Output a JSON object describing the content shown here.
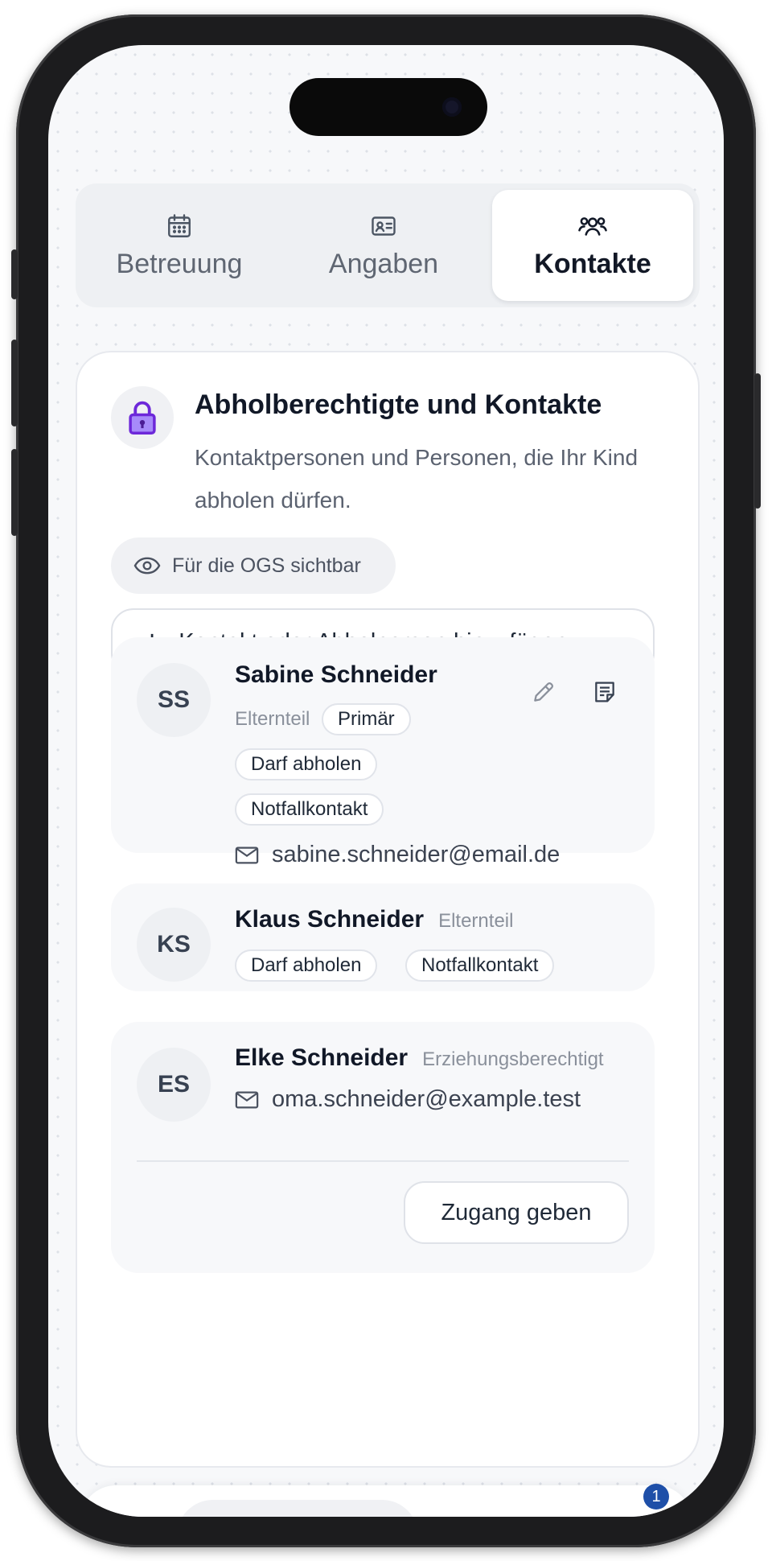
{
  "tabs": [
    {
      "label": "Betreuung",
      "icon": "calendar-icon",
      "active": false
    },
    {
      "label": "Angaben",
      "icon": "id-card-icon",
      "active": false
    },
    {
      "label": "Kontakte",
      "icon": "users-icon",
      "active": true
    }
  ],
  "section": {
    "icon": "lock-icon",
    "title": "Abholberechtigte und Kontakte",
    "description": "Kontaktpersonen und Personen, die Ihr Kind abholen dürfen.",
    "visibility_badge": "Für die OGS sichtbar",
    "add_button": "Kontakt oder Abholperson hinzufügen"
  },
  "contacts": [
    {
      "initials": "SS",
      "name": "Sabine Schneider",
      "role": "Elternteil",
      "primary_chip": "Primär",
      "chips": [
        "Darf abholen",
        "Notfallkontakt"
      ],
      "email": "sabine.schneider@email.de"
    },
    {
      "initials": "KS",
      "name": "Klaus Schneider",
      "role": "Elternteil",
      "chips": [
        "Darf abholen",
        "Notfallkontakt"
      ]
    },
    {
      "initials": "ES",
      "name": "Elke Schneider",
      "role": "Erziehungsberechtigt",
      "email": "oma.schneider@example.test",
      "access_button": "Zugang geben"
    }
  ],
  "bottom_nav": {
    "badge_count": "1"
  },
  "colors": {
    "accent_purple": "#7c3aed",
    "text_primary": "#111827",
    "badge_blue": "#1e4fa8"
  }
}
